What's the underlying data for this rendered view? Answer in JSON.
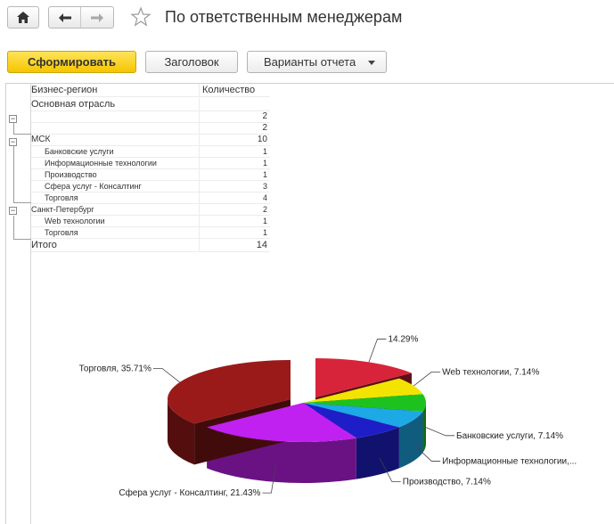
{
  "title": "По ответственным менеджерам",
  "toolbar": {
    "generate_label": "Сформировать",
    "header_label": "Заголовок",
    "variants_label": "Варианты отчета"
  },
  "icons": {
    "home": "home-icon",
    "back": "arrow-left-icon",
    "forward": "arrow-right-icon",
    "favorite": "star-icon",
    "toggle": "minus-square-icon"
  },
  "table": {
    "col_region": "Бизнес-регион",
    "col_count": "Количество",
    "group_title": "Основная отрасль",
    "rows": [
      {
        "label": "",
        "count": "2"
      },
      {
        "label": "",
        "count": "2"
      },
      {
        "label": "МСК",
        "count": "10"
      },
      {
        "label": "Банковские услуги",
        "count": "1"
      },
      {
        "label": "Информационные технологии",
        "count": "1"
      },
      {
        "label": "Производство",
        "count": "1"
      },
      {
        "label": "Сфера услуг - Консалтинг",
        "count": "3"
      },
      {
        "label": "Торговля",
        "count": "4"
      },
      {
        "label": "Санкт-Петербург",
        "count": "2"
      },
      {
        "label": "Web технологии",
        "count": "1"
      },
      {
        "label": "Торговля",
        "count": "1"
      }
    ],
    "total_label": "Итого",
    "total_count": "14"
  },
  "chart_data": {
    "type": "pie",
    "title": "",
    "slices": [
      {
        "label": "",
        "percent_label": "14.29%",
        "value": 14.29,
        "color": "#d8243a"
      },
      {
        "label": "Web технологии",
        "percent_label": "7.14%",
        "value": 7.14,
        "color": "#f2e400"
      },
      {
        "label": "Банковские услуги",
        "percent_label": "7.14%",
        "value": 7.14,
        "color": "#1ec21e"
      },
      {
        "label": "Информационные  технологии,...",
        "percent_label": "",
        "value": 7.14,
        "color": "#1da8e6"
      },
      {
        "label": "Производство",
        "percent_label": "7.14%",
        "value": 7.14,
        "color": "#1e1ec8"
      },
      {
        "label": "Сфера услуг - Консалтинг",
        "percent_label": "21.43%",
        "value": 21.43,
        "color": "#c020f0"
      },
      {
        "label": "Торговля",
        "percent_label": "35.71%",
        "value": 35.71,
        "color": "#9a1a1a"
      }
    ]
  }
}
